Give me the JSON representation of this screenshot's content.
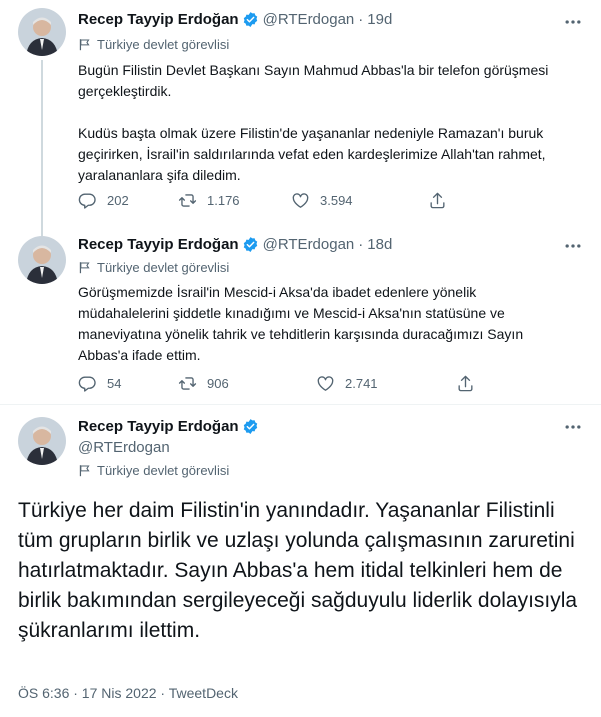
{
  "tweets": [
    {
      "author": "Recep Tayyip Erdoğan",
      "handle": "@RTErdogan",
      "time": "19d",
      "label": "Türkiye devlet görevlisi",
      "text": "Bugün Filistin Devlet Başkanı Sayın Mahmud Abbas'la bir telefon görüşmesi gerçekleştirdik.\n\nKudüs başta olmak üzere Filistin'de yaşananlar nedeniyle Ramazan'ı buruk geçirirken, İsrail'in saldırılarında vefat eden kardeşlerimize Allah'tan rahmet, yaralananlara şifa diledim.",
      "replies": "202",
      "retweets": "1.176",
      "likes": "3.594"
    },
    {
      "author": "Recep Tayyip Erdoğan",
      "handle": "@RTErdogan",
      "time": "18d",
      "label": "Türkiye devlet görevlisi",
      "text": "Görüşmemizde İsrail'in Mescid-i Aksa'da ibadet edenlere yönelik müdahalelerini şiddetle kınadığımı ve Mescid-i Aksa'nın statüsüne ve maneviyatına yönelik tahrik ve tehditlerin karşısında duracağımızı Sayın Abbas'a ifade ettim.",
      "replies": "54",
      "retweets": "906",
      "likes": "2.741"
    },
    {
      "author": "Recep Tayyip Erdoğan",
      "handle": "@RTErdogan",
      "label": "Türkiye devlet görevlisi",
      "text": "Türkiye her daim Filistin'in yanındadır. Yaşananlar Filistinli tüm grupların birlik ve uzlaşı yolunda çalışmasının zaruretini hatırlatmaktadır. Sayın Abbas'a hem itidal telkinleri hem de birlik bakımından sergileyeceği sağduyulu liderlik dolayısıyla şükranlarımı ilettim.",
      "footer": "ÖS 6:36 · 17 Nis 2022 · TweetDeck"
    }
  ],
  "colors": {
    "verified": "#1d9bf0",
    "secondary_text": "#536471",
    "thread_line": "#cfd9de"
  },
  "icons": [
    "verified-icon",
    "more-icon",
    "flag-icon",
    "reply-icon",
    "retweet-icon",
    "like-icon",
    "share-icon"
  ]
}
